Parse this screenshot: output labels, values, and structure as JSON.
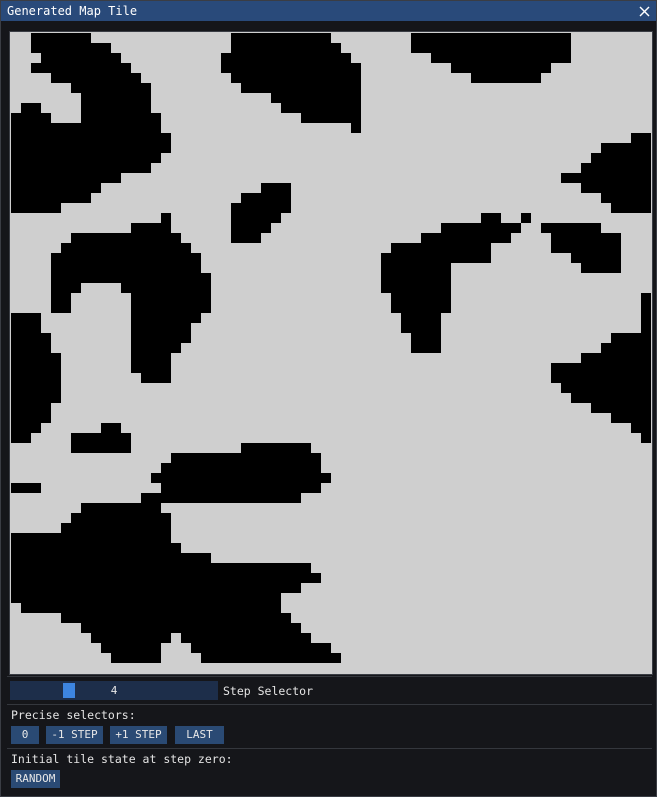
{
  "window": {
    "title": "Generated Map Tile",
    "close_icon": "close-icon"
  },
  "map": {
    "grid_size": 64,
    "colors": {
      "wall": "#000000",
      "floor": "#cfcfcf"
    },
    "rows": [
      "LLWWWWWWLLLLLLLLLLLLLLWWWWWWWWWWLLLLLLLLWWWWWWWWWWWWWWWWLLLLLLLL",
      "LLWWWWWWWWLLLLLLLLLLLLWWWWWWWWWWWLLLLLLLWWWWWWWWWWWWWWWWLLLLLLLL",
      "LLLWWWWWWWWLLLLLLLLLLWWWWWWWWWWWWWLLLLLLLLWWWWWWWWWWWWWWLLLLLLLL",
      "LLWWWWWWWWWWLLLLLLLLLWWWWWWWWWWWWWWLLLLLLLLLWWWWWWWWWWLLLLLLLLLL",
      "LLLLWWWWWWWWWLLLLLLLLLWWWWWWWWWWWWWLLLLLLLLLLLWWWWWWWLLLLLLLLLLL",
      "LLLLLLWWWWWWWWLLLLLLLLLWWWWWWWWWWWWLLLLLLLLLLLLLLLLLLLLLLLLLLLLL",
      "LLLLLLLWWWWWWWLLLLLLLLLLLLWWWWWWWWWLLLLLLLLLLLLLLLLLLLLLLLLLLLLL",
      "LWWLLLLWWWWWWWLLLLLLLLLLLLLWWWWWWWWLLLLLLLLLLLLLLLLLLLLLLLLLLLLL",
      "WWWWLLLWWWWWWWWLLLLLLLLLLLLLLWWWWWWLLLLLLLLLLLLLLLLLLLLLLLLLLLLL",
      "WWWWWWWWWWWWWWWLLLLLLLLLLLLLLLLLLLWLLLLLLLLLLLLLLLLLLLLLLLLLLLLL",
      "WWWWWWWWWWWWWWWWLLLLLLLLLLLLLLLLLLLLLLLLLLLLLLLLLLLLLLLLLLLLLLWW",
      "WWWWWWWWWWWWWWWWLLLLLLLLLLLLLLLLLLLLLLLLLLLLLLLLLLLLLLLLLLLWWWWW",
      "WWWWWWWWWWWWWWWLLLLLLLLLLLLLLLLLLLLLLLLLLLLLLLLLLLLLLLLLLLWWWWWW",
      "WWWWWWWWWWWWWWLLLLLLLLLLLLLLLLLLLLLLLLLLLLLLLLLLLLLLLLLLLWWWWWWW",
      "WWWWWWWWWWWLLLLLLLLLLLLLLLLLLLLLLLLLLLLLLLLLLLLLLLLLLLLWWWWWWWWW",
      "WWWWWWWWWLLLLLLLLLLLLLLLLWWWLLLLLLLLLLLLLLLLLLLLLLLLLLLLLWWWWWWW",
      "WWWWWWWWLLLLLLLLLLLLLLLWWWWWLLLLLLLLLLLLLLLLLLLLLLLLLLLLLLLWWWWW",
      "WWWWWLLLLLLLLLLLLLLLLLWWWWWWLLLLLLLLLLLLLLLLLLLLLLLLLLLLLLLLWWWW",
      "LLLLLLLLLLLLLLLWLLLLLLWWWWWLLLLLLLLLLLLLLLLLLLLWWLLWLLLLLLLLLLLL",
      "LLLLLLLLLLLLWWWWLLLLLLWWWWLLLLLLLLLLLLLLLLLWWWWWWWWLLWWWWWWLLLLL",
      "LLLLLLWWWWWWWWWWWLLLLLWWWLLLLLLLLLLLLLLLLWWWWWWWWWLLLLWWWWWWWLLL",
      "LLLLLWWWWWWWWWWWWWLLLLLLLLLLLLLLLLLLLLWWWWWWWWWWLLLLLLWWWWWWWLLL",
      "LLLLWWWWWWWWWWWWWWWLLLLLLLLLLLLLLLLLLWWWWWWWWWWWLLLLLLLLWWWWWLLL",
      "LLLLWWWWWWWWWWWWWWWLLLLLLLLLLLLLLLLLLWWWWWWWLLLLLLLLLLLLLWWWWLLL",
      "LLLLWWWWWWWWWWWWWWWWLLLLLLLLLLLLLLLLLWWWWWWWLLLLLLLLLLLLLLLLLLLL",
      "LLLLWWWLLLLWWWWWWWWWLLLLLLLLLLLLLLLLLWWWWWWWLLLLLLLLLLLLLLLLLLLL",
      "LLLLWWLLLLLLWWWWWWWWLLLLLLLLLLLLLLLLLLWWWWWWLLLLLLLLLLLLLLLLLLLW",
      "LLLLWWLLLLLLWWWWWWWWLLLLLLLLLLLLLLLLLLWWWWWWLLLLLLLLLLLLLLLLLLLW",
      "WWWLLLLLLLLLWWWWWWWLLLLLLLLLLLLLLLLLLLLWWWWLLLLLLLLLLLLLLLLLLLLW",
      "WWWLLLLLLLLLWWWWWWLLLLLLLLLLLLLLLLLLLLLWWWWLLLLLLLLLLLLLLLLLLLLW",
      "WWWWLLLLLLLLWWWWWWLLLLLLLLLLLLLLLLLLLLLLWWWLLLLLLLLLLLLLLLLLWWWW",
      "WWWWLLLLLLLLWWWWWLLLLLLLLLLLLLLLLLLLLLLLWWWLLLLLLLLLLLLLLLLWWWWW",
      "WWWWWLLLLLLLWWWWLLLLLLLLLLLLLLLLLLLLLLLLLLLLLLLLLLLLLLLLLWWWWWWW",
      "WWWWWLLLLLLLWWWWLLLLLLLLLLLLLLLLLLLLLLLLLLLLLLLLLLLLLLWWWWWWWWWW",
      "WWWWWLLLLLLLLWWWLLLLLLLLLLLLLLLLLLLLLLLLLLLLLLLLLLLLLLWWWWWWWWWW",
      "WWWWWLLLLLLLLLLLLLLLLLLLLLLLLLLLLLLLLLLLLLLLLLLLLLLLLLLWWWWWWWWW",
      "WWWWWLLLLLLLLLLLLLLLLLLLLLLLLLLLLLLLLLLLLLLLLLLLLLLLLLLLWWWWWWWW",
      "WWWWLLLLLLLLLLLLLLLLLLLLLLLLLLLLLLLLLLLLLLLLLLLLLLLLLLLLLLWWWWWW",
      "WWWWLLLLLLLLLLLLLLLLLLLLLLLLLLLLLLLLLLLLLLLLLLLLLLLLLLLLLLLLWWWW",
      "WWWLLLLLLWWLLLLLLLLLLLLLLLLLLLLLLLLLLLLLLLLLLLLLLLLLLLLLLLLLLLWW",
      "WWLLLLWWWWWWLLLLLLLLLLLLLLLLLLLLLLLLLLLLLLLLLLLLLLLLLLLLLLLLLLLW",
      "LLLLLLWWWWWWLLLLLLLLLLLWWWWWWWLLLLLLLLLLLLLLLLLLLLLLLLLLLLLLLLLL",
      "LLLLLLLLLLLLLLLLWWWWWWWWWWWWWWWLLLLLLLLLLLLLLLLLLLLLLLLLLLLLLLLL",
      "LLLLLLLLLLLLLLLWWWWWWWWWWWWWWWWLLLLLLLLLLLLLLLLLLLLLLLLLLLLLLLLL",
      "LLLLLLLLLLLLLLWWWWWWWWWWWWWWWWWWLLLLLLLLLLLLLLLLLLLLLLLLLLLLLLLL",
      "WWWLLLLLLLLLLLLWWWWWWWWWWWWWWWWLLLLLLLLLLLLLLLLLLLLLLLLLLLLLLLLL",
      "LLLLLLLLLLLLLWWWWWWWWWWWWWWWWLLLLLLLLLLLLLLLLLLLLLLLLLLLLLLLLLLL",
      "LLLLLLLWWWWWWWWLLLLLLLLLLLLLLLLLLLLLLLLLLLLLLLLLLLLLLLLLLLLLLLLL",
      "LLLLLLWWWWWWWWWWLLLLLLLLLLLLLLLLLLLLLLLLLLLLLLLLLLLLLLLLLLLLLLLL",
      "LLLLLWWWWWWWWWWWLLLLLLLLLLLLLLLLLLLLLLLLLLLLLLLLLLLLLLLLLLLLLLLL",
      "WWWWWWWWWWWWWWWWLLLLLLLLLLLLLLLLLLLLLLLLLLLLLLLLLLLLLLLLLLLLLLLL",
      "WWWWWWWWWWWWWWWWWLLLLLLLLLLLLLLLLLLLLLLLLLLLLLLLLLLLLLLLLLLLLLLL",
      "WWWWWWWWWWWWWWWWWWWWLLLLLLLLLLLLLLLLLLLLLLLLLLLLLLLLLLLLLLLLLLLL",
      "WWWWWWWWWWWWWWWWWWWWWWWWWWWWWWLLLLLLLLLLLLLLLLLLLLLLLLLLLLLLLLLL",
      "WWWWWWWWWWWWWWWWWWWWWWWWWWWWWWWLLLLLLLLLLLLLLLLLLLLLLLLLLLLLLLLL",
      "WWWWWWWWWWWWWWWWWWWWWWWWWWWWWLLLLLLLLLLLLLLLLLLLLLLLLLLLLLLLLLLL",
      "WWWWWWWWWWWWWWWWWWWWWWWWWWWLLLLLLLLLLLLLLLLLLLLLLLLLLLLLLLLLLLLL",
      "LWWWWWWWWWWWWWWWWWWWWWWWWWWLLLLLLLLLLLLLLLLLLLLLLLLLLLLLLLLLLLLL",
      "LLLLLWWWWWWWWWWWWWWWWWWWWWWWLLLLLLLLLLLLLLLLLLLLLLLLLLLLLLLLLLLL",
      "LLLLLLLWWWWWWWWWWWWWWWWWWWWWWLLLLLLLLLLLLLLLLLLLLLLLLLLLLLLLLLLL",
      "LLLLLLLLWWWWWWWWLWWWWWWWWWWWWWLLLLLLLLLLLLLLLLLLLLLLLLLLLLLLLLLL",
      "LLLLLLLLLWWWWWWLLLWWWWWWWWWWWWWWLLLLLLLLLLLLLLLLLLLLLLLLLLLLLLLL",
      "LLLLLLLLLLWWWWWLLLLWWWWWWWWWWWWWWLLLLLLLLLLLLLLLLLLLLLLLLLLLLLLL"
    ]
  },
  "step_selector": {
    "value": "4",
    "fraction": 0.27,
    "label": "Step Selector"
  },
  "precise": {
    "heading": "Precise selectors:",
    "buttons": [
      "0",
      "-1 STEP",
      "+1 STEP",
      "LAST"
    ]
  },
  "initial": {
    "heading": "Initial tile state at step zero:",
    "random_label": "RANDOM"
  }
}
